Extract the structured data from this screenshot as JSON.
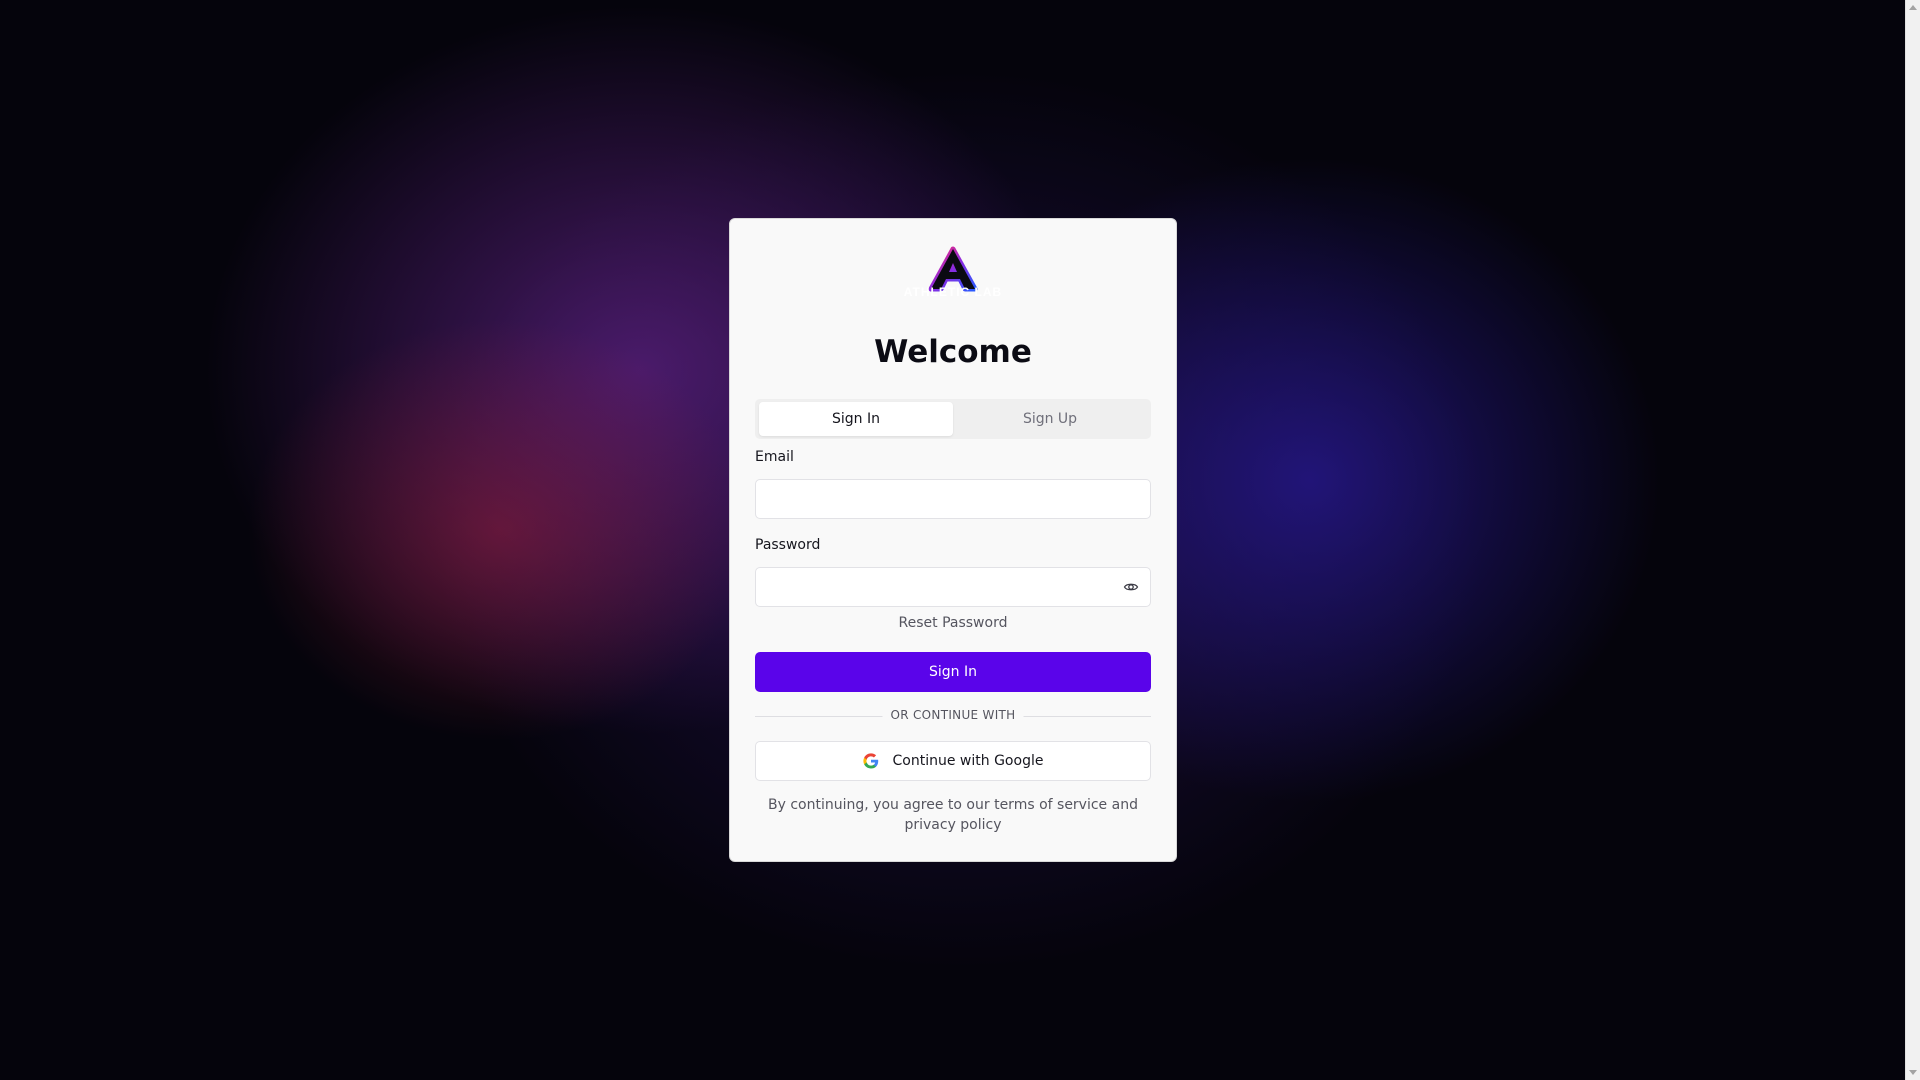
{
  "brand": {
    "logo_text": "ATHLETIC LAB",
    "logo_letter": "A"
  },
  "auth": {
    "title": "Welcome",
    "tabs": [
      {
        "label": "Sign In",
        "active": true
      },
      {
        "label": "Sign Up",
        "active": false
      }
    ],
    "email": {
      "label": "Email",
      "value": "",
      "placeholder": ""
    },
    "password": {
      "label": "Password",
      "value": "",
      "placeholder": "",
      "toggle_icon": "eye-icon"
    },
    "reset_label": "Reset Password",
    "submit_label": "Sign In",
    "divider_text": "OR CONTINUE WITH",
    "google_label": "Continue with Google",
    "google_icon": "google-icon",
    "terms_text": "By continuing, you agree to our terms of service and privacy policy"
  },
  "colors": {
    "primary": "#5a04ea",
    "card_background": "#f9f9f9",
    "page_background": "#05040c"
  }
}
